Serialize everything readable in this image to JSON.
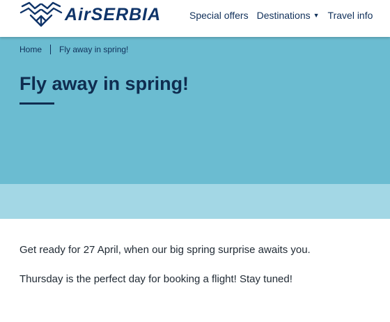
{
  "header": {
    "logo_text": "AirSERBIA",
    "nav": [
      {
        "label": "Special offers",
        "dropdown": false
      },
      {
        "label": "Destinations",
        "dropdown": true
      },
      {
        "label": "Travel info",
        "dropdown": false
      }
    ]
  },
  "breadcrumb": {
    "home": "Home",
    "current": "Fly away in spring!"
  },
  "hero": {
    "title": "Fly away in spring!"
  },
  "content": {
    "paragraphs": [
      "Get ready for 27 April, when our big spring surprise awaits you.",
      "Thursday is the perfect day for booking a flight! Stay tuned!"
    ]
  },
  "colors": {
    "brand_navy": "#0f3469",
    "hero_bg": "#6bbcd1",
    "band_bg": "#a3d7e5",
    "text": "#1f2933"
  },
  "icons": {
    "logo": "airserbia-eagle-emblem",
    "nav_caret": "caret-down-icon"
  }
}
